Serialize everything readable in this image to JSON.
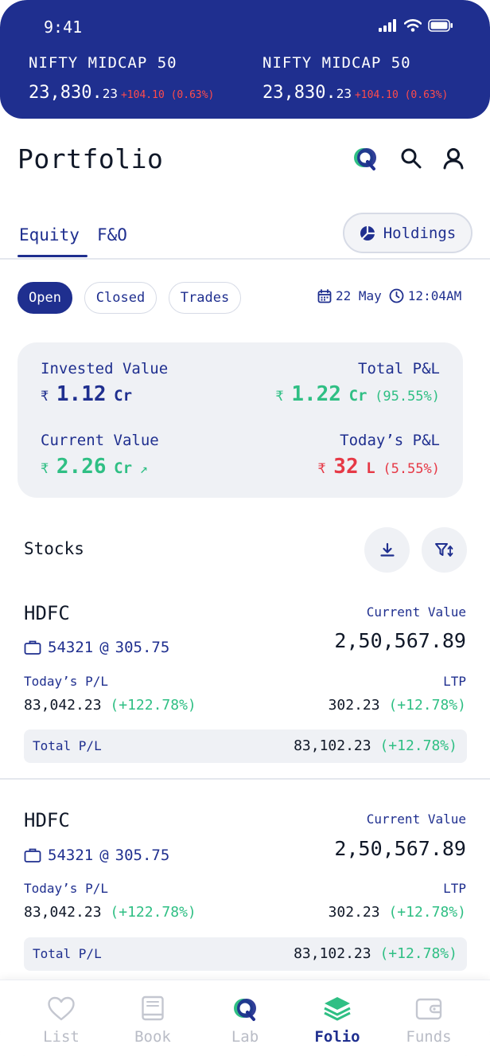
{
  "status_bar": {
    "time": "9:41"
  },
  "tickers": [
    {
      "name": "NIFTY MIDCAP 50",
      "price_main": "23,830.",
      "price_dec": "23",
      "change": "+104.10 (0.63%)"
    },
    {
      "name": "NIFTY MIDCAP 50",
      "price_main": "23,830.",
      "price_dec": "23",
      "change": "+104.10 (0.63%)"
    }
  ],
  "header": {
    "title": "Portfolio",
    "icons": [
      "q-logo-icon",
      "search-icon",
      "user-icon"
    ]
  },
  "tabs": [
    {
      "label": "Equity",
      "active": true
    },
    {
      "label": "F&O",
      "active": false
    }
  ],
  "holdings_button": {
    "label": "Holdings",
    "icon": "pie-chart-icon"
  },
  "filters": [
    {
      "label": "Open",
      "active": true
    },
    {
      "label": "Closed",
      "active": false
    },
    {
      "label": "Trades",
      "active": false
    }
  ],
  "date": "22 May",
  "time": "12:04AM",
  "summary": {
    "invested": {
      "label": "Invested Value",
      "currency": "₹",
      "value": "1.12",
      "unit": "Cr"
    },
    "total_pl": {
      "label": "Total P&L",
      "currency": "₹",
      "value": "1.22",
      "unit": "Cr",
      "pct": "(95.55%)"
    },
    "current": {
      "label": "Current Value",
      "currency": "₹",
      "value": "2.26",
      "unit": "Cr",
      "arrow": "↗"
    },
    "todays_pl": {
      "label": "Today’s P&L",
      "currency": "₹",
      "value": "32",
      "unit": "L",
      "pct": "(5.55%)"
    }
  },
  "stocks_section": {
    "title": "Stocks"
  },
  "stocks": [
    {
      "symbol": "HDFC",
      "qty": "54321",
      "at": "@",
      "avg": "305.75",
      "current_value_label": "Current Value",
      "current_value": "2,50,567.89",
      "todays_pl_label": "Today’s P/L",
      "todays_pl": "83,042.23",
      "todays_pl_pct": "(+122.78%)",
      "ltp_label": "LTP",
      "ltp": "302.23",
      "ltp_pct": "(+12.78%)",
      "total_pl_label": "Total P/L",
      "total_pl": "83,102.23",
      "total_pl_pct": "(+12.78%)"
    },
    {
      "symbol": "HDFC",
      "qty": "54321",
      "at": "@",
      "avg": "305.75",
      "current_value_label": "Current Value",
      "current_value": "2,50,567.89",
      "todays_pl_label": "Today’s P/L",
      "todays_pl": "83,042.23",
      "todays_pl_pct": "(+122.78%)",
      "ltp_label": "LTP",
      "ltp": "302.23",
      "ltp_pct": "(+12.78%)",
      "total_pl_label": "Total P/L",
      "total_pl": "83,102.23",
      "total_pl_pct": "(+12.78%)"
    }
  ],
  "bottom_nav": [
    {
      "label": "List",
      "icon": "heart-icon"
    },
    {
      "label": "Book",
      "icon": "book-icon"
    },
    {
      "label": "Lab",
      "icon": "q-logo-icon"
    },
    {
      "label": "Folio",
      "icon": "layers-icon",
      "active": true
    },
    {
      "label": "Funds",
      "icon": "wallet-icon"
    }
  ],
  "colors": {
    "primary": "#1f2f8f",
    "positive": "#2fbf84",
    "negative": "#e63946",
    "card_bg": "#eff1f5"
  }
}
